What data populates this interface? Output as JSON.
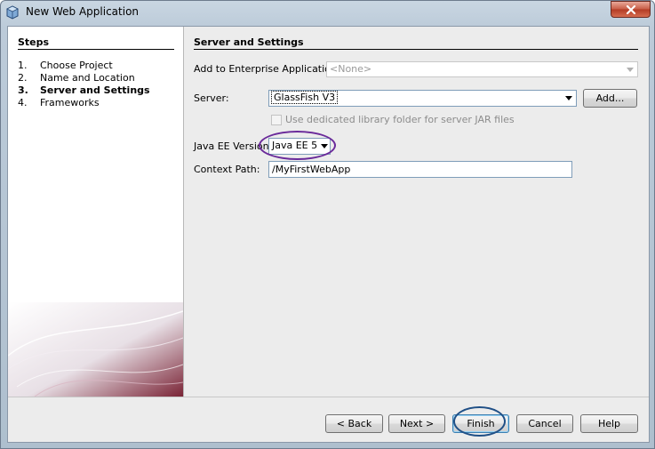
{
  "window": {
    "title": "New Web Application"
  },
  "steps": {
    "title": "Steps",
    "items": [
      {
        "num": "1.",
        "label": "Choose Project"
      },
      {
        "num": "2.",
        "label": "Name and Location"
      },
      {
        "num": "3.",
        "label": "Server and Settings"
      },
      {
        "num": "4.",
        "label": "Frameworks"
      }
    ],
    "current_index": 2
  },
  "content": {
    "title": "Server and Settings",
    "enterprise_app": {
      "label": "Add to Enterprise Application:",
      "value": "<None>"
    },
    "server": {
      "label": "Server:",
      "value": "GlassFish V3",
      "add_label": "Add..."
    },
    "dedicated_folder": {
      "label": "Use dedicated library folder for server JAR files",
      "checked": false
    },
    "java_ee": {
      "label": "Java EE Version:",
      "value": "Java EE 5"
    },
    "context_path": {
      "label": "Context Path:",
      "value": "/MyFirstWebApp"
    }
  },
  "buttons": {
    "back": "< Back",
    "next": "Next >",
    "finish": "Finish",
    "cancel": "Cancel",
    "help": "Help"
  },
  "colors": {
    "highlight_purple": "#6a2a9a",
    "highlight_blue": "#1f4f86",
    "close_red": "#c75b44"
  },
  "icons": {
    "app": "netbeans-cube-icon",
    "close": "close-icon",
    "dropdown": "chevron-down-icon"
  }
}
